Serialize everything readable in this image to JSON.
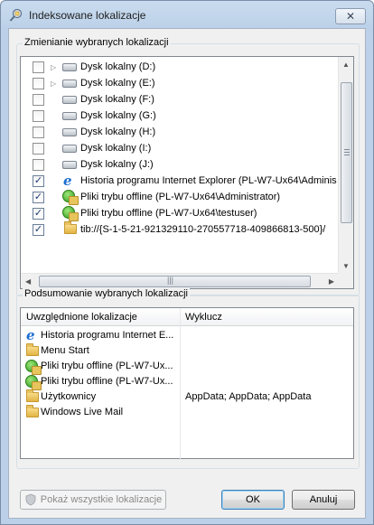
{
  "window": {
    "title": "Indeksowane lokalizacje",
    "close_glyph": "✕"
  },
  "change_group": {
    "label": "Zmienianie wybranych lokalizacji",
    "items": [
      {
        "label": "Dysk lokalny (D:)",
        "checked": false,
        "expandable": true,
        "icon": "drive-icon"
      },
      {
        "label": "Dysk lokalny (E:)",
        "checked": false,
        "expandable": true,
        "icon": "drive-icon"
      },
      {
        "label": "Dysk lokalny (F:)",
        "checked": false,
        "expandable": false,
        "icon": "drive-icon"
      },
      {
        "label": "Dysk lokalny (G:)",
        "checked": false,
        "expandable": false,
        "icon": "drive-icon"
      },
      {
        "label": "Dysk lokalny (H:)",
        "checked": false,
        "expandable": false,
        "icon": "drive-icon"
      },
      {
        "label": "Dysk lokalny (I:)",
        "checked": false,
        "expandable": false,
        "icon": "drive-icon"
      },
      {
        "label": "Dysk lokalny (J:)",
        "checked": false,
        "expandable": false,
        "icon": "drive-icon"
      },
      {
        "label": "Historia programu Internet Explorer (PL-W7-Ux64\\Adminis",
        "checked": true,
        "expandable": false,
        "icon": "internet-explorer-icon"
      },
      {
        "label": "Pliki trybu offline (PL-W7-Ux64\\Administrator)",
        "checked": true,
        "expandable": false,
        "icon": "sync-center-icon"
      },
      {
        "label": "Pliki trybu offline (PL-W7-Ux64\\testuser)",
        "checked": true,
        "expandable": false,
        "icon": "sync-center-icon"
      },
      {
        "label": "tib://{S-1-5-21-921329110-270557718-409866813-500}/",
        "checked": true,
        "expandable": false,
        "icon": "folder-icon"
      }
    ],
    "scroll_up": "▲",
    "scroll_down": "▼",
    "scroll_left": "◀",
    "scroll_right": "▶",
    "grip": "|||"
  },
  "summary_group": {
    "label": "Podsumowanie wybranych lokalizacji",
    "columns": [
      "Uwzględnione lokalizacje",
      "Wyklucz"
    ],
    "rows": [
      {
        "name": "Historia programu Internet E...",
        "exclude": "",
        "icon": "internet-explorer-icon"
      },
      {
        "name": "Menu Start",
        "exclude": "",
        "icon": "folder-icon"
      },
      {
        "name": "Pliki trybu offline (PL-W7-Ux...",
        "exclude": "",
        "icon": "sync-center-icon"
      },
      {
        "name": "Pliki trybu offline (PL-W7-Ux...",
        "exclude": "",
        "icon": "sync-center-icon"
      },
      {
        "name": "Użytkownicy",
        "exclude": "AppData; AppData; AppData",
        "icon": "folder-icon"
      },
      {
        "name": "Windows Live Mail",
        "exclude": "",
        "icon": "folder-icon"
      }
    ]
  },
  "buttons": {
    "show_all": "Pokaż wszystkie lokalizacje",
    "ok": "OK",
    "cancel": "Anuluj"
  }
}
